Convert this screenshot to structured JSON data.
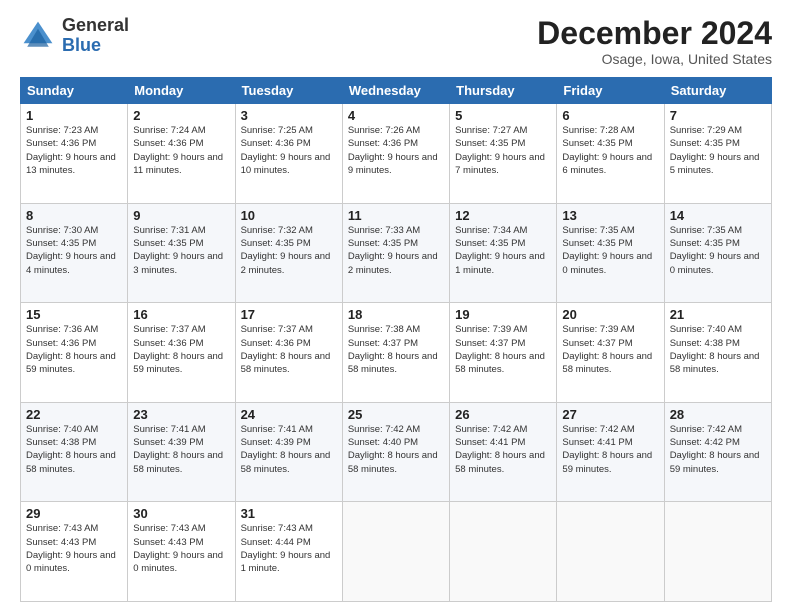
{
  "logo": {
    "general": "General",
    "blue": "Blue"
  },
  "title": "December 2024",
  "location": "Osage, Iowa, United States",
  "days_of_week": [
    "Sunday",
    "Monday",
    "Tuesday",
    "Wednesday",
    "Thursday",
    "Friday",
    "Saturday"
  ],
  "weeks": [
    [
      {
        "day": "1",
        "sunrise": "7:23 AM",
        "sunset": "4:36 PM",
        "daylight": "9 hours and 13 minutes."
      },
      {
        "day": "2",
        "sunrise": "7:24 AM",
        "sunset": "4:36 PM",
        "daylight": "9 hours and 11 minutes."
      },
      {
        "day": "3",
        "sunrise": "7:25 AM",
        "sunset": "4:36 PM",
        "daylight": "9 hours and 10 minutes."
      },
      {
        "day": "4",
        "sunrise": "7:26 AM",
        "sunset": "4:36 PM",
        "daylight": "9 hours and 9 minutes."
      },
      {
        "day": "5",
        "sunrise": "7:27 AM",
        "sunset": "4:35 PM",
        "daylight": "9 hours and 7 minutes."
      },
      {
        "day": "6",
        "sunrise": "7:28 AM",
        "sunset": "4:35 PM",
        "daylight": "9 hours and 6 minutes."
      },
      {
        "day": "7",
        "sunrise": "7:29 AM",
        "sunset": "4:35 PM",
        "daylight": "9 hours and 5 minutes."
      }
    ],
    [
      {
        "day": "8",
        "sunrise": "7:30 AM",
        "sunset": "4:35 PM",
        "daylight": "9 hours and 4 minutes."
      },
      {
        "day": "9",
        "sunrise": "7:31 AM",
        "sunset": "4:35 PM",
        "daylight": "9 hours and 3 minutes."
      },
      {
        "day": "10",
        "sunrise": "7:32 AM",
        "sunset": "4:35 PM",
        "daylight": "9 hours and 2 minutes."
      },
      {
        "day": "11",
        "sunrise": "7:33 AM",
        "sunset": "4:35 PM",
        "daylight": "9 hours and 2 minutes."
      },
      {
        "day": "12",
        "sunrise": "7:34 AM",
        "sunset": "4:35 PM",
        "daylight": "9 hours and 1 minute."
      },
      {
        "day": "13",
        "sunrise": "7:35 AM",
        "sunset": "4:35 PM",
        "daylight": "9 hours and 0 minutes."
      },
      {
        "day": "14",
        "sunrise": "7:35 AM",
        "sunset": "4:35 PM",
        "daylight": "9 hours and 0 minutes."
      }
    ],
    [
      {
        "day": "15",
        "sunrise": "7:36 AM",
        "sunset": "4:36 PM",
        "daylight": "8 hours and 59 minutes."
      },
      {
        "day": "16",
        "sunrise": "7:37 AM",
        "sunset": "4:36 PM",
        "daylight": "8 hours and 59 minutes."
      },
      {
        "day": "17",
        "sunrise": "7:37 AM",
        "sunset": "4:36 PM",
        "daylight": "8 hours and 58 minutes."
      },
      {
        "day": "18",
        "sunrise": "7:38 AM",
        "sunset": "4:37 PM",
        "daylight": "8 hours and 58 minutes."
      },
      {
        "day": "19",
        "sunrise": "7:39 AM",
        "sunset": "4:37 PM",
        "daylight": "8 hours and 58 minutes."
      },
      {
        "day": "20",
        "sunrise": "7:39 AM",
        "sunset": "4:37 PM",
        "daylight": "8 hours and 58 minutes."
      },
      {
        "day": "21",
        "sunrise": "7:40 AM",
        "sunset": "4:38 PM",
        "daylight": "8 hours and 58 minutes."
      }
    ],
    [
      {
        "day": "22",
        "sunrise": "7:40 AM",
        "sunset": "4:38 PM",
        "daylight": "8 hours and 58 minutes."
      },
      {
        "day": "23",
        "sunrise": "7:41 AM",
        "sunset": "4:39 PM",
        "daylight": "8 hours and 58 minutes."
      },
      {
        "day": "24",
        "sunrise": "7:41 AM",
        "sunset": "4:39 PM",
        "daylight": "8 hours and 58 minutes."
      },
      {
        "day": "25",
        "sunrise": "7:42 AM",
        "sunset": "4:40 PM",
        "daylight": "8 hours and 58 minutes."
      },
      {
        "day": "26",
        "sunrise": "7:42 AM",
        "sunset": "4:41 PM",
        "daylight": "8 hours and 58 minutes."
      },
      {
        "day": "27",
        "sunrise": "7:42 AM",
        "sunset": "4:41 PM",
        "daylight": "8 hours and 59 minutes."
      },
      {
        "day": "28",
        "sunrise": "7:42 AM",
        "sunset": "4:42 PM",
        "daylight": "8 hours and 59 minutes."
      }
    ],
    [
      {
        "day": "29",
        "sunrise": "7:43 AM",
        "sunset": "4:43 PM",
        "daylight": "9 hours and 0 minutes."
      },
      {
        "day": "30",
        "sunrise": "7:43 AM",
        "sunset": "4:43 PM",
        "daylight": "9 hours and 0 minutes."
      },
      {
        "day": "31",
        "sunrise": "7:43 AM",
        "sunset": "4:44 PM",
        "daylight": "9 hours and 1 minute."
      },
      null,
      null,
      null,
      null
    ]
  ],
  "labels": {
    "sunrise": "Sunrise:",
    "sunset": "Sunset:",
    "daylight": "Daylight:"
  }
}
